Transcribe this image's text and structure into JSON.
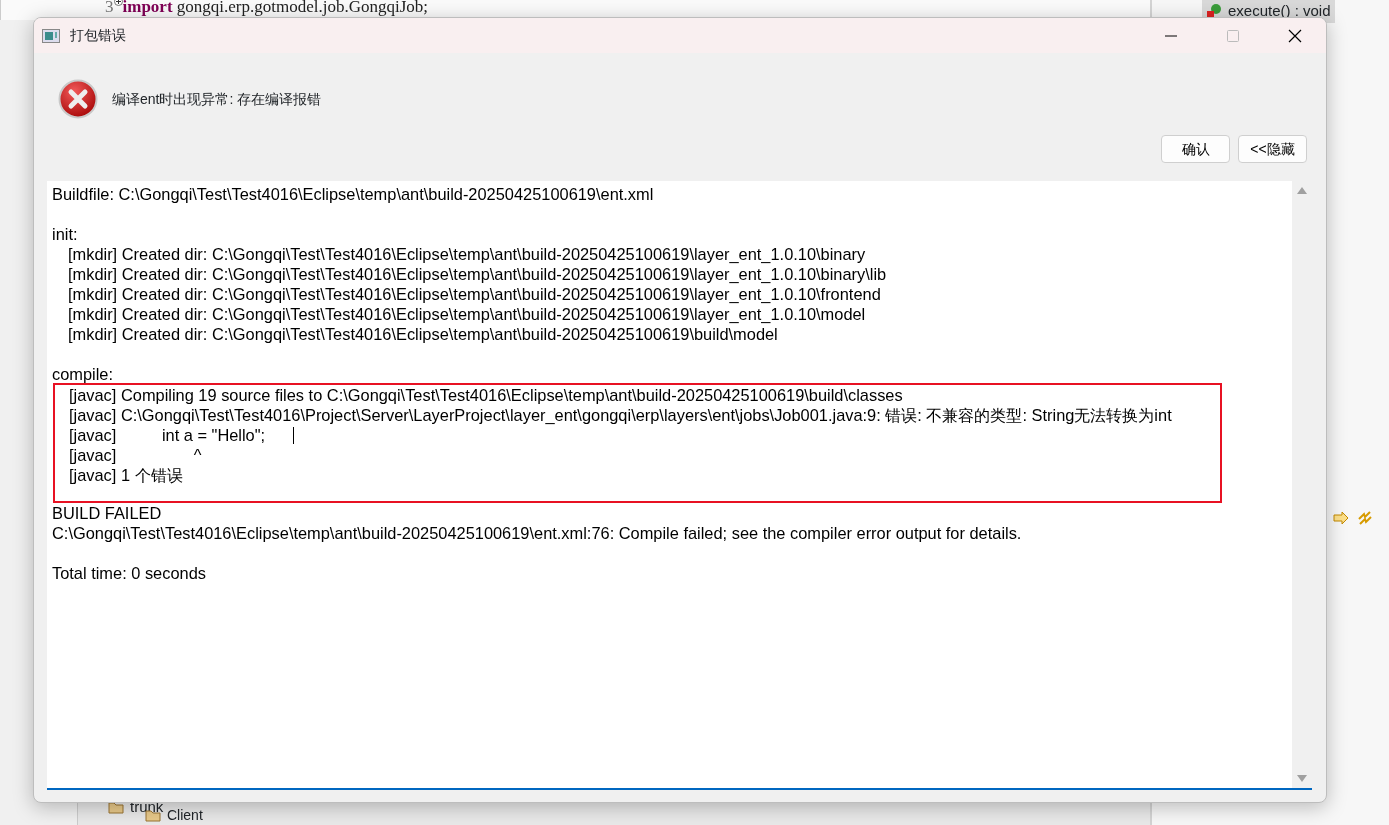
{
  "background": {
    "code_line_number": "3",
    "code_keyword": "import",
    "code_text": "gongqi.erp.gotmodel.job.GongqiJob;",
    "outline_item": "execute() : void",
    "tree_items": [
      "trunk",
      "Client"
    ]
  },
  "window": {
    "title": "打包错误"
  },
  "message": {
    "kind": "error",
    "text": "编译ent时出现异常: 存在编译报错"
  },
  "buttons": [
    {
      "label": "确认"
    },
    {
      "label": "<<隐藏"
    }
  ],
  "log_lines": [
    {
      "kind": "plain",
      "text": "Buildfile: C:\\Gongqi\\Test\\Test4016\\Eclipse\\temp\\ant\\build-20250425100619\\ent.xml",
      "highlighted": false
    },
    {
      "kind": "blank",
      "highlighted": false
    },
    {
      "kind": "plain",
      "text": "init:",
      "highlighted": false
    },
    {
      "kind": "task",
      "text": "[mkdir] Created dir: C:\\Gongqi\\Test\\Test4016\\Eclipse\\temp\\ant\\build-20250425100619\\layer_ent_1.0.10\\binary",
      "highlighted": false
    },
    {
      "kind": "task",
      "text": "[mkdir] Created dir: C:\\Gongqi\\Test\\Test4016\\Eclipse\\temp\\ant\\build-20250425100619\\layer_ent_1.0.10\\binary\\lib",
      "highlighted": false
    },
    {
      "kind": "task",
      "text": "[mkdir] Created dir: C:\\Gongqi\\Test\\Test4016\\Eclipse\\temp\\ant\\build-20250425100619\\layer_ent_1.0.10\\frontend",
      "highlighted": false
    },
    {
      "kind": "task",
      "text": "[mkdir] Created dir: C:\\Gongqi\\Test\\Test4016\\Eclipse\\temp\\ant\\build-20250425100619\\layer_ent_1.0.10\\model",
      "highlighted": false
    },
    {
      "kind": "task",
      "text": "[mkdir] Created dir: C:\\Gongqi\\Test\\Test4016\\Eclipse\\temp\\ant\\build-20250425100619\\build\\model",
      "highlighted": false
    },
    {
      "kind": "blank",
      "highlighted": false
    },
    {
      "kind": "plain",
      "text": "compile:",
      "highlighted": false
    },
    {
      "kind": "task",
      "text": "[javac] Compiling 19 source files to C:\\Gongqi\\Test\\Test4016\\Eclipse\\temp\\ant\\build-20250425100619\\build\\classes",
      "highlighted": true
    },
    {
      "kind": "task",
      "text": "[javac] C:\\Gongqi\\Test\\Test4016\\Project\\Server\\LayerProject\\layer_ent\\gongqi\\erp\\layers\\ent\\jobs\\Job001.java:9: 错误: 不兼容的类型: String无法转换为int",
      "highlighted": true
    },
    {
      "kind": "task",
      "text": "[javac]          int a = \"Hello\";",
      "highlighted": true,
      "cursor": true
    },
    {
      "kind": "task",
      "text": "[javac]                 ^",
      "highlighted": true
    },
    {
      "kind": "task",
      "text": "[javac] 1 个错误",
      "highlighted": true
    },
    {
      "kind": "plain",
      "text": "BUILD FAILED",
      "highlighted": false
    },
    {
      "kind": "plain",
      "text": "C:\\Gongqi\\Test\\Test4016\\Eclipse\\temp\\ant\\build-20250425100619\\ent.xml:76: Compile failed; see the compiler error output for details.",
      "highlighted": false
    },
    {
      "kind": "blank",
      "highlighted": false
    },
    {
      "kind": "plain",
      "text": "Total time: 0 seconds",
      "highlighted": false
    }
  ]
}
